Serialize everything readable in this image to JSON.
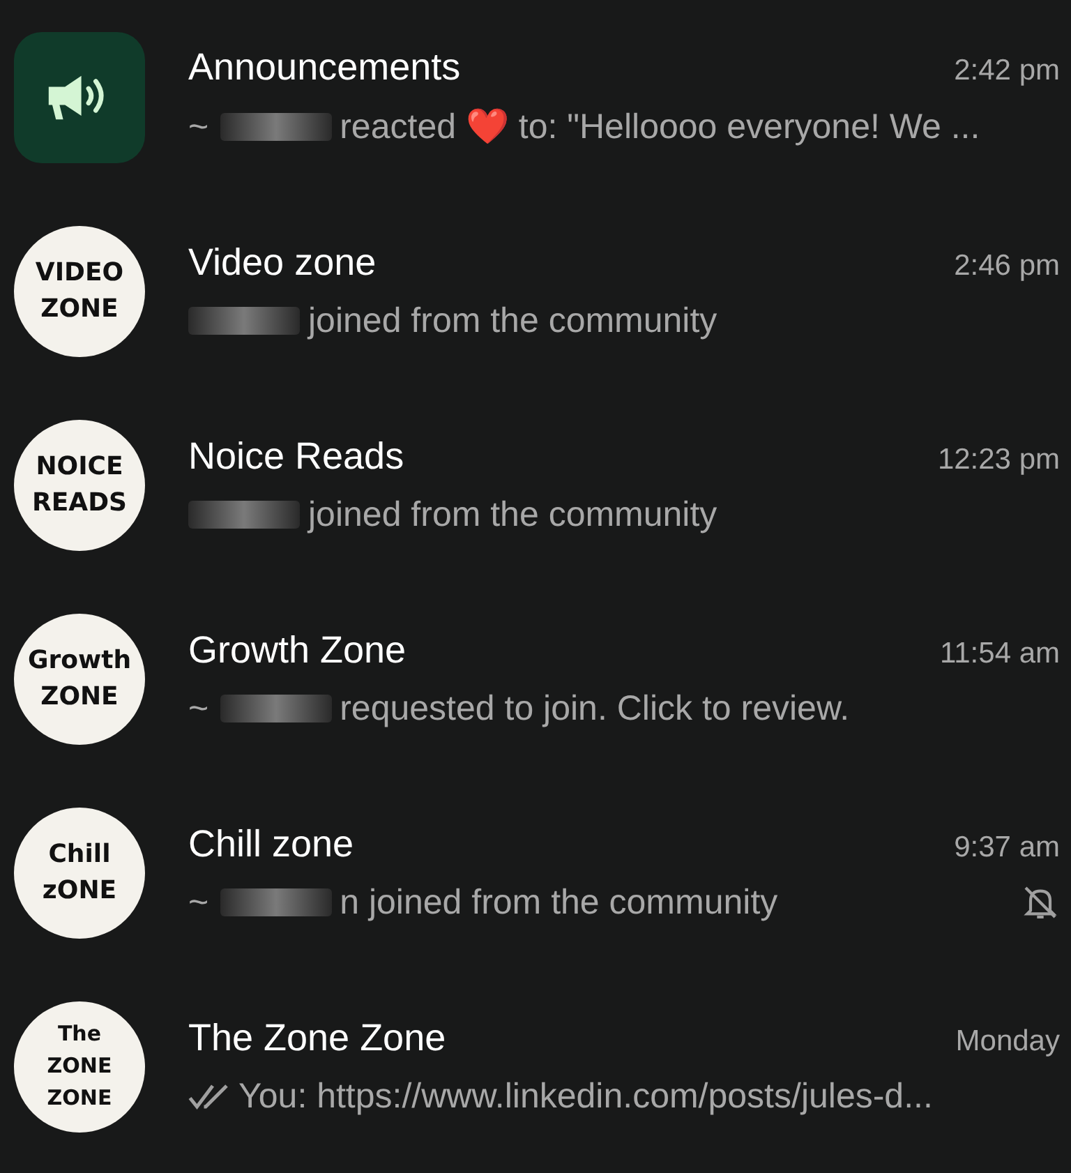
{
  "chats": [
    {
      "name": "Announcements",
      "time": "2:42 pm",
      "avatar": {
        "kind": "icon"
      },
      "preview": {
        "prefix": "~",
        "redacted": true,
        "text": "reacted ❤️ to: \"Helloooo everyone!  We ..."
      },
      "muted": false,
      "read_ticks": false
    },
    {
      "name": "Video zone",
      "time": "2:46 pm",
      "avatar": {
        "kind": "text",
        "lines": [
          "VIDEO",
          "ZONE"
        ]
      },
      "preview": {
        "redacted": true,
        "text": "joined from the community"
      },
      "muted": false,
      "read_ticks": false
    },
    {
      "name": "Noice Reads",
      "time": "12:23 pm",
      "avatar": {
        "kind": "text",
        "lines": [
          "NOICE",
          "READS"
        ]
      },
      "preview": {
        "redacted": true,
        "text": "joined from the community"
      },
      "muted": false,
      "read_ticks": false
    },
    {
      "name": "Growth Zone",
      "time": "11:54 am",
      "avatar": {
        "kind": "text",
        "lines": [
          "Growth",
          "ZONE"
        ]
      },
      "preview": {
        "prefix": "~",
        "redacted": true,
        "text": "requested to join. Click to review."
      },
      "muted": false,
      "read_ticks": false
    },
    {
      "name": "Chill zone",
      "time": "9:37 am",
      "avatar": {
        "kind": "text",
        "lines": [
          "Chill",
          "zONE"
        ]
      },
      "preview": {
        "prefix": "~",
        "redacted": true,
        "text": "n joined from the community"
      },
      "muted": true,
      "read_ticks": false
    },
    {
      "name": "The Zone Zone",
      "time": "Monday",
      "avatar": {
        "kind": "text",
        "lines": [
          "The",
          "ZONE",
          "ZONE"
        ]
      },
      "preview": {
        "redacted": false,
        "text": "You: https://www.linkedin.com/posts/jules-d..."
      },
      "muted": false,
      "read_ticks": true
    }
  ]
}
